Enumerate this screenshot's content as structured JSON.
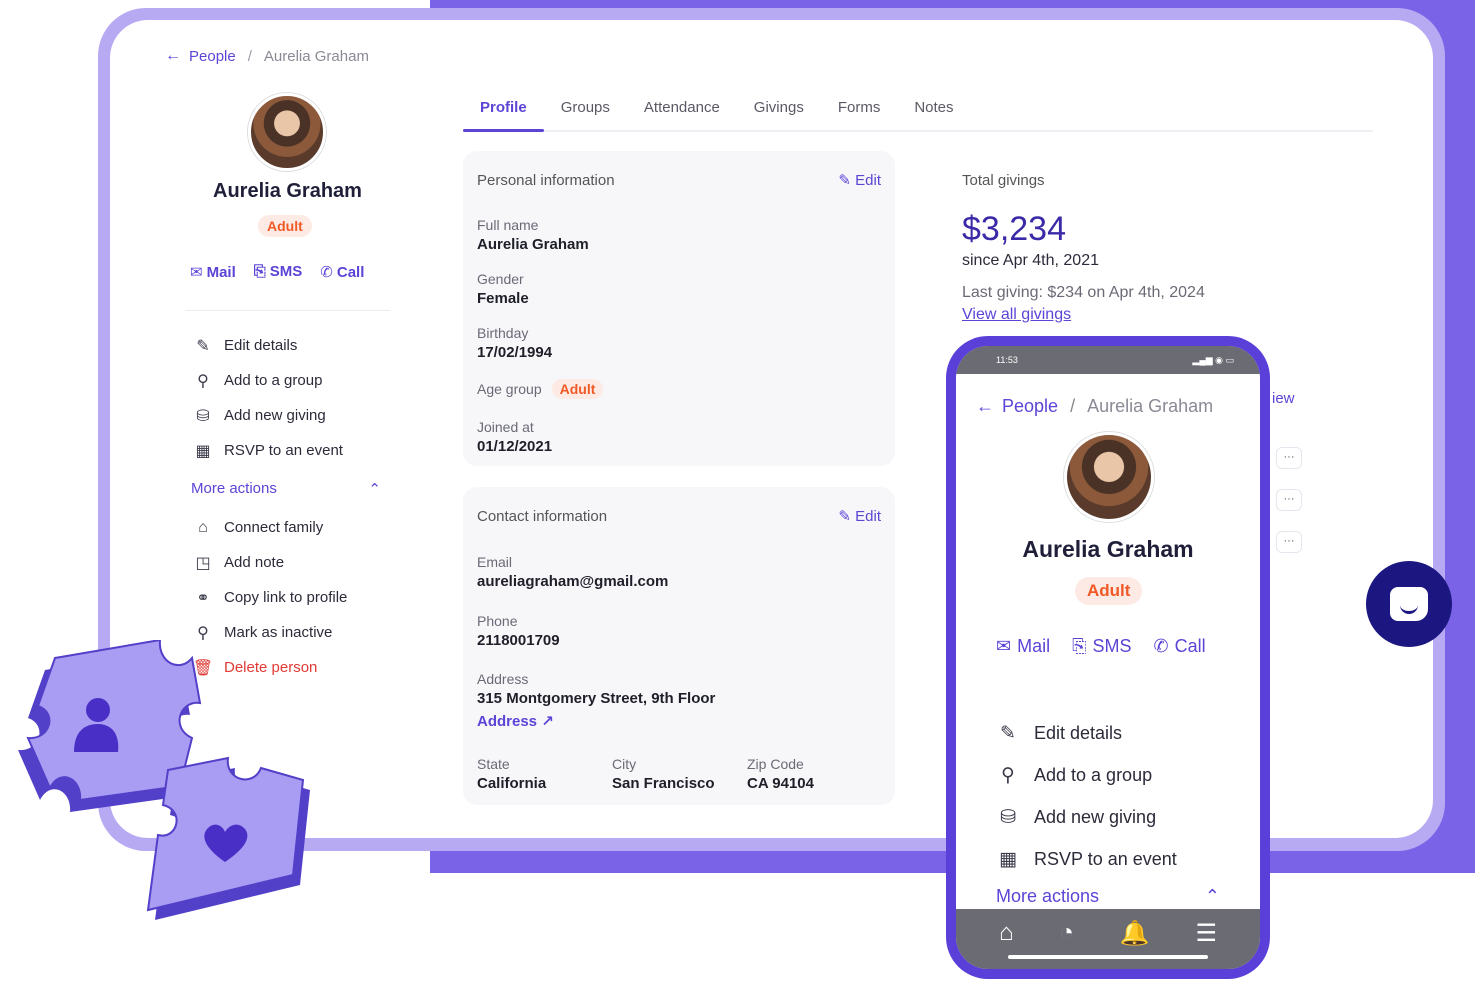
{
  "breadcrumb": {
    "back_icon": "←",
    "parent": "People",
    "separator": "/",
    "current": "Aurelia Graham"
  },
  "person": {
    "name": "Aurelia Graham",
    "badge": "Adult"
  },
  "contacts": {
    "mail": "Mail",
    "sms": "SMS",
    "call": "Call",
    "mail_icon": "✉",
    "sms_icon": "⎘",
    "call_icon": "✆"
  },
  "actions": [
    {
      "icon": "✎",
      "label": "Edit details"
    },
    {
      "icon": "⚲",
      "label": "Add to a group"
    },
    {
      "icon": "⛁",
      "label": "Add new giving"
    },
    {
      "icon": "▦",
      "label": "RSVP to an event"
    }
  ],
  "more_actions": {
    "label": "More actions",
    "chevron": "⌃"
  },
  "more_action_items": [
    {
      "icon": "⌂",
      "label": "Connect family"
    },
    {
      "icon": "◳",
      "label": "Add note"
    },
    {
      "icon": "⚭",
      "label": "Copy link to profile"
    },
    {
      "icon": "⚲",
      "label": "Mark as inactive"
    },
    {
      "icon": "🗑",
      "label": "Delete person"
    }
  ],
  "tabs": [
    "Profile",
    "Groups",
    "Attendance",
    "Givings",
    "Forms",
    "Notes"
  ],
  "personal_info": {
    "title": "Personal information",
    "edit": "Edit",
    "edit_icon": "✎",
    "full_name_label": "Full name",
    "full_name": "Aurelia Graham",
    "gender_label": "Gender",
    "gender": "Female",
    "birthday_label": "Birthday",
    "birthday": "17/02/1994",
    "age_group_label": "Age group",
    "age_group": "Adult",
    "joined_label": "Joined at",
    "joined": "01/12/2021"
  },
  "contact_info": {
    "title": "Contact information",
    "edit": "Edit",
    "edit_icon": "✎",
    "email_label": "Email",
    "email": "aureliagraham@gmail.com",
    "phone_label": "Phone",
    "phone": "2118001709",
    "address_label": "Address",
    "address": "315 Montgomery Street, 9th Floor",
    "address_link": "Address ↗",
    "state_label": "State",
    "state": "California",
    "city_label": "City",
    "city": "San Francisco",
    "zip_label": "Zip Code",
    "zip": "CA 94104"
  },
  "givings": {
    "title": "Total givings",
    "amount": "$3,234",
    "since": "since Apr 4th, 2021",
    "last": "Last giving: $234 on Apr 4th, 2024",
    "view_all": "View all givings"
  },
  "peek": {
    "view": "iew",
    "dots": "···"
  },
  "phone": {
    "time": "11:53",
    "status_icons": "▂▄▆ ◉ ▭",
    "nav_icons": [
      "⌂",
      "◔",
      "🔔",
      "☰"
    ]
  },
  "colors": {
    "accent": "#5b45d6",
    "frame": "#b7aaf3",
    "slab": "#7a63e6",
    "badge_text": "#f05a26",
    "fab": "#1c1680"
  }
}
